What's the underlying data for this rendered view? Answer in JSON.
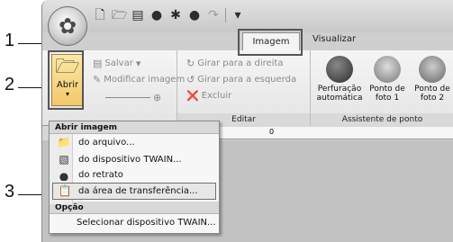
{
  "title_bar": {
    "app_icon": "embroidery-flower-icon",
    "quick_access": [
      "new-document-icon",
      "open-folder-icon",
      "save-icon",
      "undo-icon",
      "redo-icon"
    ]
  },
  "tabs": {
    "active": "Imagem",
    "others": [
      "Visualizar"
    ]
  },
  "ribbon": {
    "file_group": {
      "open_label": "Abrir",
      "save_label": "Salvar",
      "modify_label": "Modificar imagem"
    },
    "edit_group": {
      "label": "Editar",
      "rotate_right": "Girar para a direita",
      "rotate_left": "Girar para a esquerda",
      "delete": "Excluir"
    },
    "assistant_group": {
      "label": "Assistente de ponto",
      "buttons": [
        {
          "label": "Perfuração automática"
        },
        {
          "label": "Ponto de foto 1"
        },
        {
          "label": "Ponto de foto 2"
        }
      ]
    }
  },
  "ruler": {
    "mark": "0"
  },
  "menu": {
    "section1": "Abrir imagem",
    "items": [
      {
        "label": "do arquivo...",
        "icon": "folder-icon"
      },
      {
        "label": "do dispositivo TWAIN...",
        "icon": "scanner-icon"
      },
      {
        "label": "do retrato",
        "icon": "portrait-icon"
      },
      {
        "label": "da área de transferência...",
        "icon": "clipboard-icon"
      }
    ],
    "section2": "Opção",
    "option_item": "Selecionar dispositivo TWAIN..."
  },
  "callouts": [
    "1",
    "2",
    "3"
  ]
}
